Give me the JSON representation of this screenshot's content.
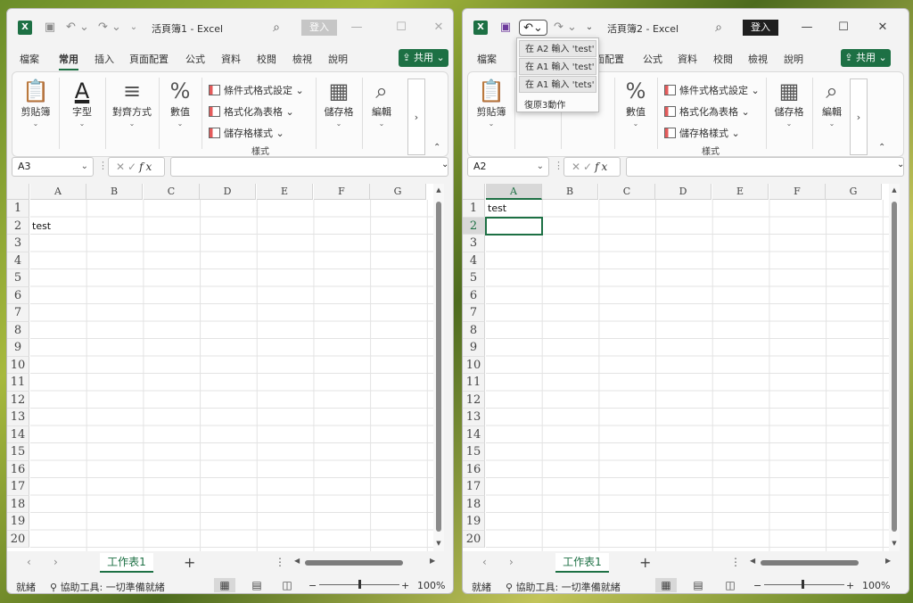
{
  "windows": [
    {
      "title": "活頁簿1 - Excel",
      "signin": "登入",
      "tabs": [
        "檔案",
        "常用",
        "插入",
        "頁面配置",
        "公式",
        "資料",
        "校閱",
        "檢視",
        "說明"
      ],
      "active_tab": "常用",
      "share": "共用",
      "ribbon": {
        "clipboard": "剪貼簿",
        "font": "字型",
        "alignment": "對齊方式",
        "number": "數值",
        "conditional": "條件式格式設定",
        "format_table": "格式化為表格",
        "cell_styles": "儲存格樣式",
        "styles": "樣式",
        "cells": "儲存格",
        "editing": "編輯"
      },
      "namebox": "A3",
      "formula": "",
      "columns": [
        "A",
        "B",
        "C",
        "D",
        "E",
        "F",
        "G"
      ],
      "rows": [
        "1",
        "2",
        "3",
        "4",
        "5",
        "6",
        "7",
        "8",
        "9",
        "10",
        "11",
        "12",
        "13",
        "14",
        "15",
        "16",
        "17",
        "18",
        "19",
        "20"
      ],
      "cells": {
        "A2": "test"
      },
      "sheet_tab": "工作表1",
      "status": "就緒",
      "accessibility": "協助工具: 一切準備就緒",
      "zoom": "100%"
    },
    {
      "title": "活頁簿2 - Excel",
      "signin": "登入",
      "tabs": [
        "檔案",
        "常用",
        "插入",
        "頁面配置",
        "公式",
        "資料",
        "校閱",
        "檢視",
        "說明"
      ],
      "active_tab": "常用",
      "share": "共用",
      "ribbon": {
        "clipboard": "剪貼簿",
        "number": "數值",
        "conditional": "條件式格式設定",
        "format_table": "格式化為表格",
        "cell_styles": "儲存格樣式",
        "styles": "樣式",
        "cells": "儲存格",
        "editing": "編輯"
      },
      "namebox": "A2",
      "formula": "",
      "columns": [
        "A",
        "B",
        "C",
        "D",
        "E",
        "F",
        "G"
      ],
      "rows": [
        "1",
        "2",
        "3",
        "4",
        "5",
        "6",
        "7",
        "8",
        "9",
        "10",
        "11",
        "12",
        "13",
        "14",
        "15",
        "16",
        "17",
        "18",
        "19",
        "20"
      ],
      "cells": {
        "A1": "test"
      },
      "sheet_tab": "工作表1",
      "status": "就緒",
      "accessibility": "協助工具: 一切準備就緒",
      "zoom": "100%",
      "undo_dropdown": {
        "items": [
          "在 A2 輸入 'test'",
          "在 A1 輸入 'test'",
          "在 A1 輸入 'tets'"
        ],
        "footer": "復原3動作"
      }
    }
  ]
}
